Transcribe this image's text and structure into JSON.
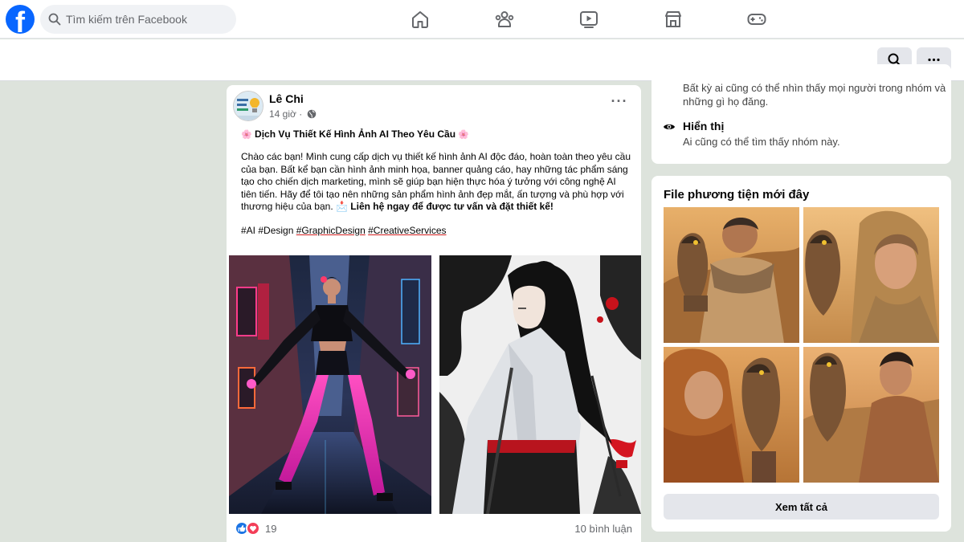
{
  "nav": {
    "search_placeholder": "Tìm kiếm trên Facebook",
    "brand_color": "#0866ff",
    "icons": [
      "home-icon",
      "groups-icon",
      "video-icon",
      "marketplace-icon",
      "gaming-icon"
    ]
  },
  "post": {
    "author": "Lê Chi",
    "time": "14 giờ ·",
    "title": "Dịch Vụ Thiết Kế Hình Ảnh AI Theo Yêu Cầu",
    "title_emoji": "🌸",
    "body": "Chào các bạn! Mình cung cấp dịch vụ thiết kế hình ảnh AI độc đáo, hoàn toàn theo yêu cầu của bạn. Bất kể bạn cần hình ảnh minh họa, banner quảng cáo, hay những tác phẩm sáng tạo cho chiến dịch marketing, mình sẽ giúp bạn hiện thực hóa ý tưởng với công nghệ AI tiên tiến. Hãy để tôi tạo nên những sản phẩm hình ảnh đẹp mắt, ấn tượng và phù hợp với thương hiệu của bạn.",
    "cta_emoji": "📩",
    "cta": "Liên hệ ngay để được tư vấn và đặt thiết kế!",
    "tags": [
      "#AI",
      "#Design",
      "#GraphicDesign",
      "#CreativeServices"
    ],
    "reaction_count": "19",
    "comment_count": "10 bình luận",
    "reaction_icons": [
      "like-icon",
      "love-icon"
    ]
  },
  "about": {
    "privacy_desc": "Bất kỳ ai cũng có thể nhìn thấy mọi người trong nhóm và những gì họ đăng.",
    "visible_title": "Hiển thị",
    "visible_desc": "Ai cũng có thể tìm thấy nhóm này."
  },
  "media": {
    "title": "File phương tiện mới đây",
    "see_all": "Xem tất cả"
  }
}
